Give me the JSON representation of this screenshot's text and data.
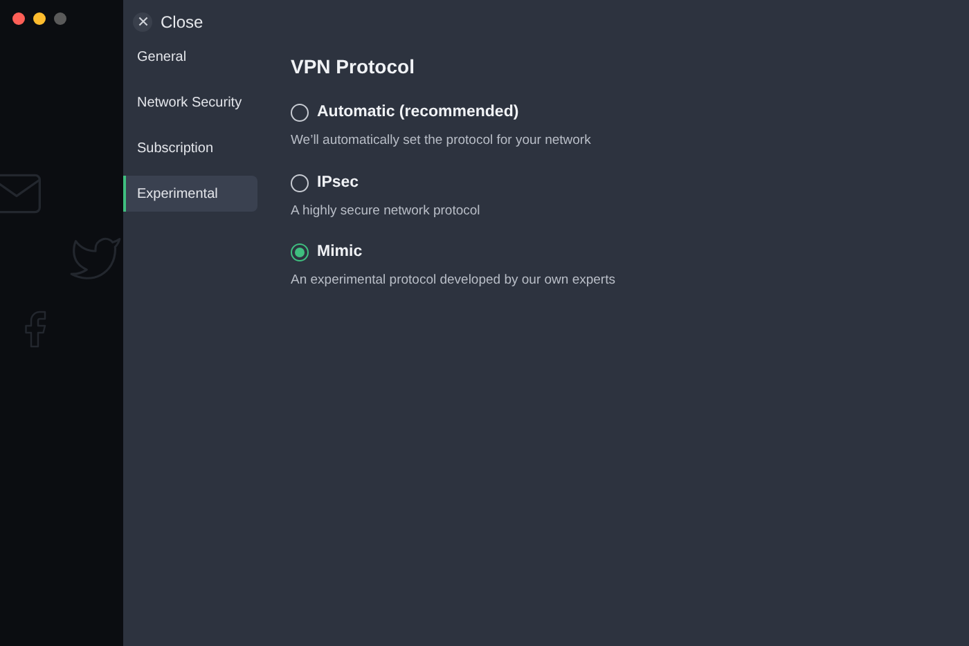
{
  "close_button": {
    "label": "Close"
  },
  "sidebar": {
    "items": [
      {
        "label": "General",
        "selected": false
      },
      {
        "label": "Network Security",
        "selected": false
      },
      {
        "label": "Subscription",
        "selected": false
      },
      {
        "label": "Experimental",
        "selected": true
      }
    ]
  },
  "section": {
    "title": "VPN Protocol",
    "options": [
      {
        "label": "Automatic (recommended)",
        "description": "We’ll automatically set the protocol for your network",
        "selected": false
      },
      {
        "label": "IPsec",
        "description": "A highly secure network protocol",
        "selected": false
      },
      {
        "label": "Mimic",
        "description": "An experimental protocol developed by our own experts",
        "selected": true
      }
    ]
  }
}
